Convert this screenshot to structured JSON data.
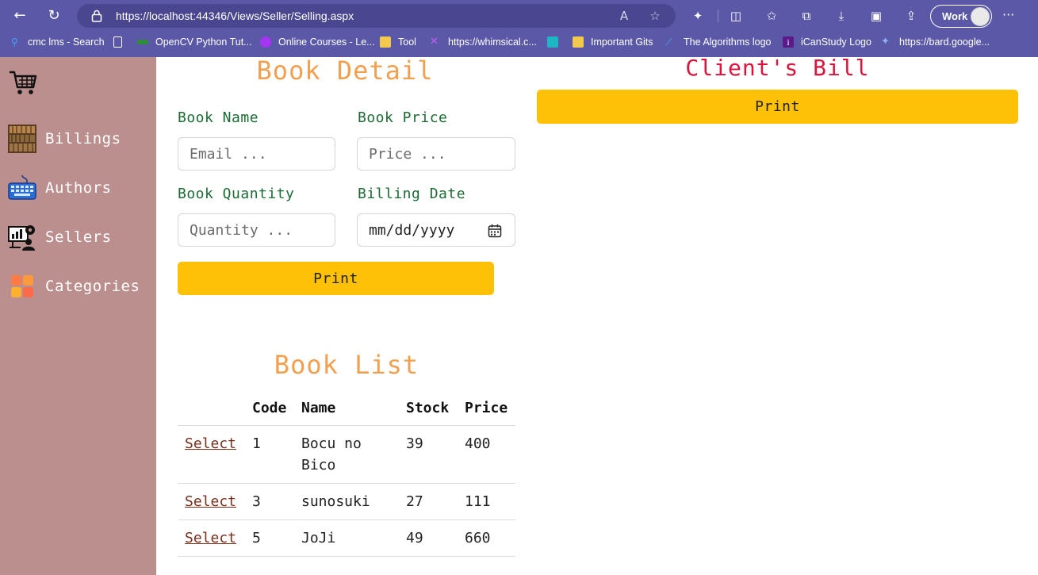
{
  "browser": {
    "url": "https://localhost:44346/Views/Seller/Selling.aspx",
    "profile_label": "Work",
    "bookmarks": [
      {
        "label": "cmc lms - Search",
        "icon": "search-icon"
      },
      {
        "label": "",
        "icon": "page-icon"
      },
      {
        "label": "OpenCV Python Tut...",
        "icon": "opencv-icon"
      },
      {
        "label": "Online Courses - Le...",
        "icon": "udemy-icon"
      },
      {
        "label": "Tool",
        "icon": "folder-icon"
      },
      {
        "label": "https://whimsical.c...",
        "icon": "whimsical-icon"
      },
      {
        "label": "",
        "icon": "image-icon"
      },
      {
        "label": "Important Gits",
        "icon": "folder-icon"
      },
      {
        "label": "The Algorithms logo",
        "icon": "algorithms-icon"
      },
      {
        "label": "iCanStudy Logo",
        "icon": "icanstudy-icon"
      },
      {
        "label": "https://bard.google...",
        "icon": "bard-icon"
      }
    ]
  },
  "sidebar": {
    "items": [
      {
        "label": "Billings",
        "icon": "bookshelf-icon"
      },
      {
        "label": "Authors",
        "icon": "keyboard-icon"
      },
      {
        "label": "Sellers",
        "icon": "analytics-icon"
      },
      {
        "label": "Categories",
        "icon": "grid-icon"
      }
    ]
  },
  "book_detail": {
    "title": "Book Detail",
    "book_name_label": "Book Name",
    "book_name_placeholder": "Email ...",
    "book_price_label": "Book Price",
    "book_price_placeholder": "Price ...",
    "book_quantity_label": "Book Quantity",
    "book_quantity_placeholder": "Quantity ...",
    "billing_date_label": "Billing Date",
    "billing_date_value": "mm/dd/yyyy",
    "print_label": "Print"
  },
  "book_list": {
    "title": "Book List",
    "columns": [
      "",
      "Code",
      "Name",
      "Stock",
      "Price"
    ],
    "rows": [
      {
        "action": "Select",
        "code": "1",
        "name": [
          "Bocu no",
          "Bico"
        ],
        "stock": "39",
        "price": "400"
      },
      {
        "action": "Select",
        "code": "3",
        "name": [
          "sunosuki"
        ],
        "stock": "27",
        "price": "111"
      },
      {
        "action": "Select",
        "code": "5",
        "name": [
          "JoJi"
        ],
        "stock": "49",
        "price": "660"
      }
    ]
  },
  "client_bill": {
    "title": "Client's Bill",
    "print_label": "Print"
  },
  "colors": {
    "sidebar": "#bc8f8f",
    "heading_orange": "#f0a050",
    "heading_red": "#dc143c",
    "label_green": "#1d6b34",
    "button_yellow": "#ffc107",
    "browser_chrome": "#5b58a8"
  }
}
